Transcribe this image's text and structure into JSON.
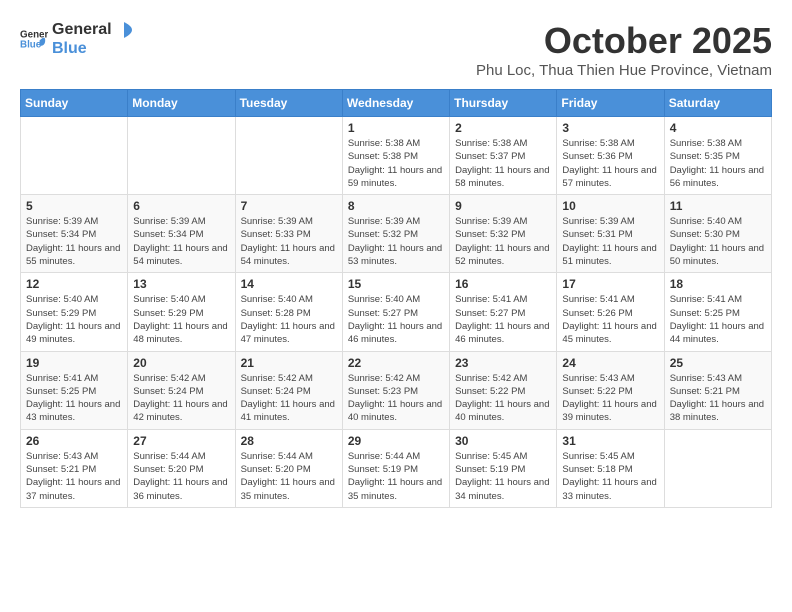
{
  "logo": {
    "general": "General",
    "blue": "Blue"
  },
  "header": {
    "month_title": "October 2025",
    "subtitle": "Phu Loc, Thua Thien Hue Province, Vietnam"
  },
  "weekdays": [
    "Sunday",
    "Monday",
    "Tuesday",
    "Wednesday",
    "Thursday",
    "Friday",
    "Saturday"
  ],
  "weeks": [
    [
      {
        "day": "",
        "sunrise": "",
        "sunset": "",
        "daylight": ""
      },
      {
        "day": "",
        "sunrise": "",
        "sunset": "",
        "daylight": ""
      },
      {
        "day": "",
        "sunrise": "",
        "sunset": "",
        "daylight": ""
      },
      {
        "day": "1",
        "sunrise": "Sunrise: 5:38 AM",
        "sunset": "Sunset: 5:38 PM",
        "daylight": "Daylight: 11 hours and 59 minutes."
      },
      {
        "day": "2",
        "sunrise": "Sunrise: 5:38 AM",
        "sunset": "Sunset: 5:37 PM",
        "daylight": "Daylight: 11 hours and 58 minutes."
      },
      {
        "day": "3",
        "sunrise": "Sunrise: 5:38 AM",
        "sunset": "Sunset: 5:36 PM",
        "daylight": "Daylight: 11 hours and 57 minutes."
      },
      {
        "day": "4",
        "sunrise": "Sunrise: 5:38 AM",
        "sunset": "Sunset: 5:35 PM",
        "daylight": "Daylight: 11 hours and 56 minutes."
      }
    ],
    [
      {
        "day": "5",
        "sunrise": "Sunrise: 5:39 AM",
        "sunset": "Sunset: 5:34 PM",
        "daylight": "Daylight: 11 hours and 55 minutes."
      },
      {
        "day": "6",
        "sunrise": "Sunrise: 5:39 AM",
        "sunset": "Sunset: 5:34 PM",
        "daylight": "Daylight: 11 hours and 54 minutes."
      },
      {
        "day": "7",
        "sunrise": "Sunrise: 5:39 AM",
        "sunset": "Sunset: 5:33 PM",
        "daylight": "Daylight: 11 hours and 54 minutes."
      },
      {
        "day": "8",
        "sunrise": "Sunrise: 5:39 AM",
        "sunset": "Sunset: 5:32 PM",
        "daylight": "Daylight: 11 hours and 53 minutes."
      },
      {
        "day": "9",
        "sunrise": "Sunrise: 5:39 AM",
        "sunset": "Sunset: 5:32 PM",
        "daylight": "Daylight: 11 hours and 52 minutes."
      },
      {
        "day": "10",
        "sunrise": "Sunrise: 5:39 AM",
        "sunset": "Sunset: 5:31 PM",
        "daylight": "Daylight: 11 hours and 51 minutes."
      },
      {
        "day": "11",
        "sunrise": "Sunrise: 5:40 AM",
        "sunset": "Sunset: 5:30 PM",
        "daylight": "Daylight: 11 hours and 50 minutes."
      }
    ],
    [
      {
        "day": "12",
        "sunrise": "Sunrise: 5:40 AM",
        "sunset": "Sunset: 5:29 PM",
        "daylight": "Daylight: 11 hours and 49 minutes."
      },
      {
        "day": "13",
        "sunrise": "Sunrise: 5:40 AM",
        "sunset": "Sunset: 5:29 PM",
        "daylight": "Daylight: 11 hours and 48 minutes."
      },
      {
        "day": "14",
        "sunrise": "Sunrise: 5:40 AM",
        "sunset": "Sunset: 5:28 PM",
        "daylight": "Daylight: 11 hours and 47 minutes."
      },
      {
        "day": "15",
        "sunrise": "Sunrise: 5:40 AM",
        "sunset": "Sunset: 5:27 PM",
        "daylight": "Daylight: 11 hours and 46 minutes."
      },
      {
        "day": "16",
        "sunrise": "Sunrise: 5:41 AM",
        "sunset": "Sunset: 5:27 PM",
        "daylight": "Daylight: 11 hours and 46 minutes."
      },
      {
        "day": "17",
        "sunrise": "Sunrise: 5:41 AM",
        "sunset": "Sunset: 5:26 PM",
        "daylight": "Daylight: 11 hours and 45 minutes."
      },
      {
        "day": "18",
        "sunrise": "Sunrise: 5:41 AM",
        "sunset": "Sunset: 5:25 PM",
        "daylight": "Daylight: 11 hours and 44 minutes."
      }
    ],
    [
      {
        "day": "19",
        "sunrise": "Sunrise: 5:41 AM",
        "sunset": "Sunset: 5:25 PM",
        "daylight": "Daylight: 11 hours and 43 minutes."
      },
      {
        "day": "20",
        "sunrise": "Sunrise: 5:42 AM",
        "sunset": "Sunset: 5:24 PM",
        "daylight": "Daylight: 11 hours and 42 minutes."
      },
      {
        "day": "21",
        "sunrise": "Sunrise: 5:42 AM",
        "sunset": "Sunset: 5:24 PM",
        "daylight": "Daylight: 11 hours and 41 minutes."
      },
      {
        "day": "22",
        "sunrise": "Sunrise: 5:42 AM",
        "sunset": "Sunset: 5:23 PM",
        "daylight": "Daylight: 11 hours and 40 minutes."
      },
      {
        "day": "23",
        "sunrise": "Sunrise: 5:42 AM",
        "sunset": "Sunset: 5:22 PM",
        "daylight": "Daylight: 11 hours and 40 minutes."
      },
      {
        "day": "24",
        "sunrise": "Sunrise: 5:43 AM",
        "sunset": "Sunset: 5:22 PM",
        "daylight": "Daylight: 11 hours and 39 minutes."
      },
      {
        "day": "25",
        "sunrise": "Sunrise: 5:43 AM",
        "sunset": "Sunset: 5:21 PM",
        "daylight": "Daylight: 11 hours and 38 minutes."
      }
    ],
    [
      {
        "day": "26",
        "sunrise": "Sunrise: 5:43 AM",
        "sunset": "Sunset: 5:21 PM",
        "daylight": "Daylight: 11 hours and 37 minutes."
      },
      {
        "day": "27",
        "sunrise": "Sunrise: 5:44 AM",
        "sunset": "Sunset: 5:20 PM",
        "daylight": "Daylight: 11 hours and 36 minutes."
      },
      {
        "day": "28",
        "sunrise": "Sunrise: 5:44 AM",
        "sunset": "Sunset: 5:20 PM",
        "daylight": "Daylight: 11 hours and 35 minutes."
      },
      {
        "day": "29",
        "sunrise": "Sunrise: 5:44 AM",
        "sunset": "Sunset: 5:19 PM",
        "daylight": "Daylight: 11 hours and 35 minutes."
      },
      {
        "day": "30",
        "sunrise": "Sunrise: 5:45 AM",
        "sunset": "Sunset: 5:19 PM",
        "daylight": "Daylight: 11 hours and 34 minutes."
      },
      {
        "day": "31",
        "sunrise": "Sunrise: 5:45 AM",
        "sunset": "Sunset: 5:18 PM",
        "daylight": "Daylight: 11 hours and 33 minutes."
      },
      {
        "day": "",
        "sunrise": "",
        "sunset": "",
        "daylight": ""
      }
    ]
  ]
}
